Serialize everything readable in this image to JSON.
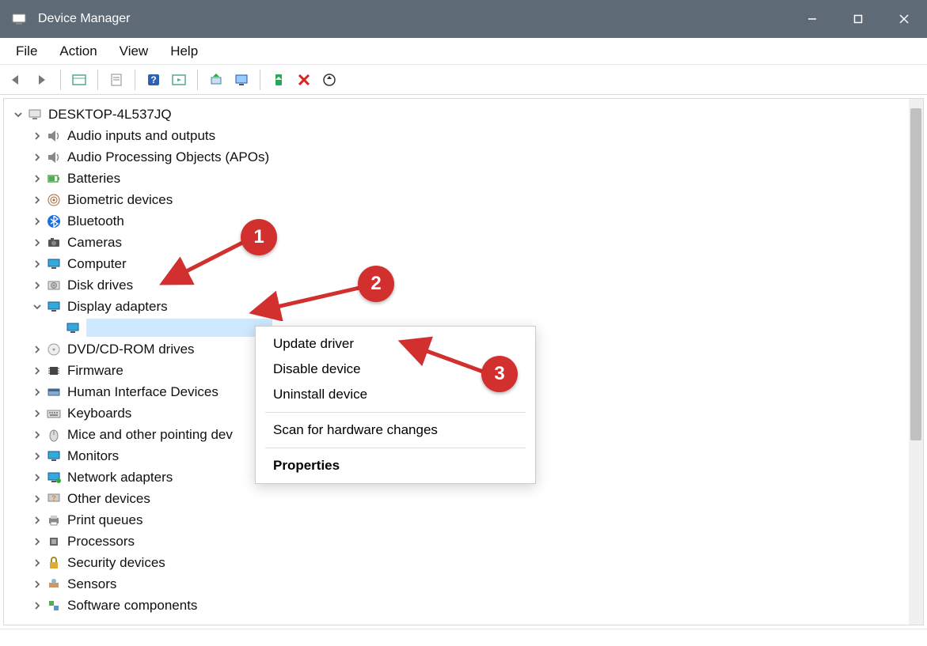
{
  "window": {
    "title": "Device Manager"
  },
  "menu": {
    "file": "File",
    "action": "Action",
    "view": "View",
    "help": "Help"
  },
  "tree": {
    "root": "DESKTOP-4L537JQ",
    "categories": [
      {
        "label": "Audio inputs and outputs",
        "icon": "speaker"
      },
      {
        "label": "Audio Processing Objects (APOs)",
        "icon": "speaker"
      },
      {
        "label": "Batteries",
        "icon": "battery"
      },
      {
        "label": "Biometric devices",
        "icon": "fingerprint"
      },
      {
        "label": "Bluetooth",
        "icon": "bluetooth"
      },
      {
        "label": "Cameras",
        "icon": "camera"
      },
      {
        "label": "Computer",
        "icon": "monitor"
      },
      {
        "label": "Disk drives",
        "icon": "disk"
      },
      {
        "label": "Display adapters",
        "icon": "monitor",
        "expanded": true
      },
      {
        "label": "DVD/CD-ROM drives",
        "icon": "disc"
      },
      {
        "label": "Firmware",
        "icon": "chip"
      },
      {
        "label": "Human Interface Devices",
        "icon": "hid"
      },
      {
        "label": "Keyboards",
        "icon": "keyboard"
      },
      {
        "label": "Mice and other pointing devices",
        "icon": "mouse",
        "truncated": "Mice and other pointing dev"
      },
      {
        "label": "Monitors",
        "icon": "monitor"
      },
      {
        "label": "Network adapters",
        "icon": "network"
      },
      {
        "label": "Other devices",
        "icon": "question"
      },
      {
        "label": "Print queues",
        "icon": "printer"
      },
      {
        "label": "Processors",
        "icon": "cpu"
      },
      {
        "label": "Security devices",
        "icon": "lock"
      },
      {
        "label": "Sensors",
        "icon": "sensor"
      },
      {
        "label": "Software components",
        "icon": "component"
      }
    ],
    "selected_child": {
      "label": ""
    }
  },
  "context_menu": {
    "items": [
      {
        "label": "Update driver"
      },
      {
        "label": "Disable device"
      },
      {
        "label": "Uninstall device"
      }
    ],
    "scan": "Scan for hardware changes",
    "properties": "Properties"
  },
  "annotations": {
    "badge1": "1",
    "badge2": "2",
    "badge3": "3"
  }
}
